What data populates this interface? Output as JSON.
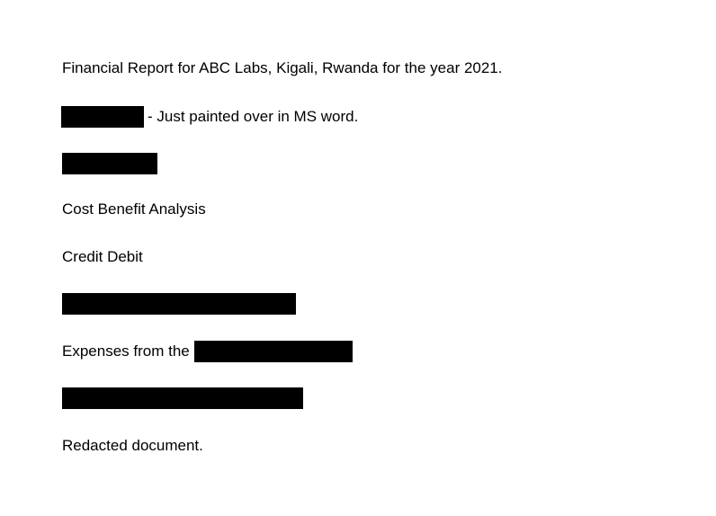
{
  "document": {
    "title_line": "Financial Report for ABC Labs, Kigali, Rwanda for the year 2021.",
    "painted_note": "- Just painted over in MS word.",
    "section_heading": "Cost Benefit Analysis",
    "columns_line": "Credit Debit",
    "expenses_prefix": "Expenses from the",
    "closing_line": "Redacted document."
  }
}
